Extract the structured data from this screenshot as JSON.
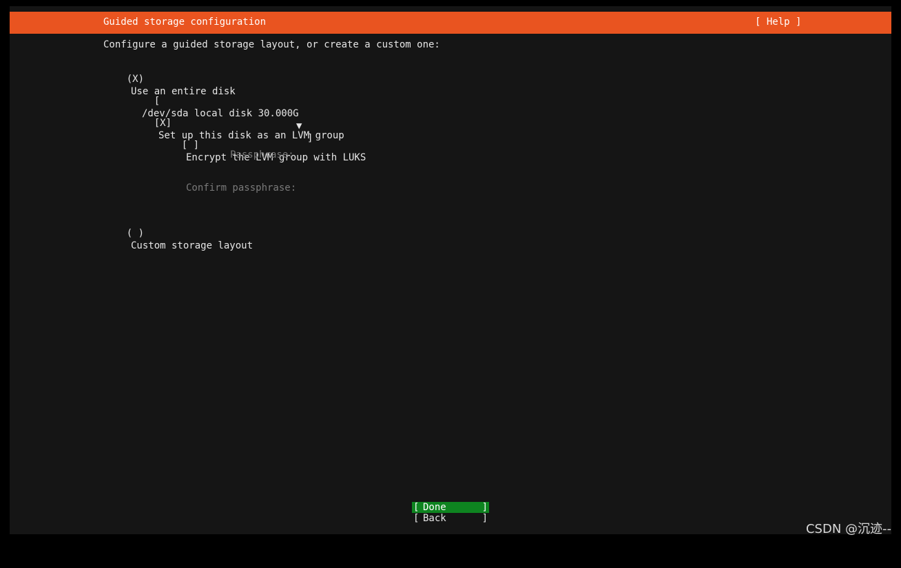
{
  "header": {
    "title": "Guided storage configuration",
    "help_label": "[ Help ]"
  },
  "intro": "Configure a guided storage layout, or create a custom one:",
  "options": {
    "entire_disk": {
      "marker": "(X)",
      "label": "Use an entire disk",
      "selected": true
    },
    "disk_select": {
      "open": "[",
      "value": "/dev/sda local disk 30.000G",
      "arrow": "▼",
      "close": "]"
    },
    "lvm": {
      "marker": "[X]",
      "label": "Set up this disk as an LVM group",
      "checked": true
    },
    "luks": {
      "marker": "[ ]",
      "label": "Encrypt the LVM group with LUKS",
      "checked": false
    },
    "passphrase": {
      "label": "Passphrase:",
      "value": ""
    },
    "confirm_passphrase": {
      "label": "Confirm passphrase:",
      "value": ""
    },
    "custom": {
      "marker": "( )",
      "label": "Custom storage layout",
      "selected": false
    }
  },
  "buttons": {
    "done": {
      "open": "[",
      "label": "Done",
      "close": "]"
    },
    "back": {
      "open": "[",
      "label": "Back",
      "close": "]"
    }
  },
  "watermark": "CSDN @沉迹--",
  "colors": {
    "accent": "#e95420",
    "focus": "#0e8420",
    "background": "#151515",
    "text": "#e6e6e6",
    "disabled_text": "#7a7a7a"
  }
}
